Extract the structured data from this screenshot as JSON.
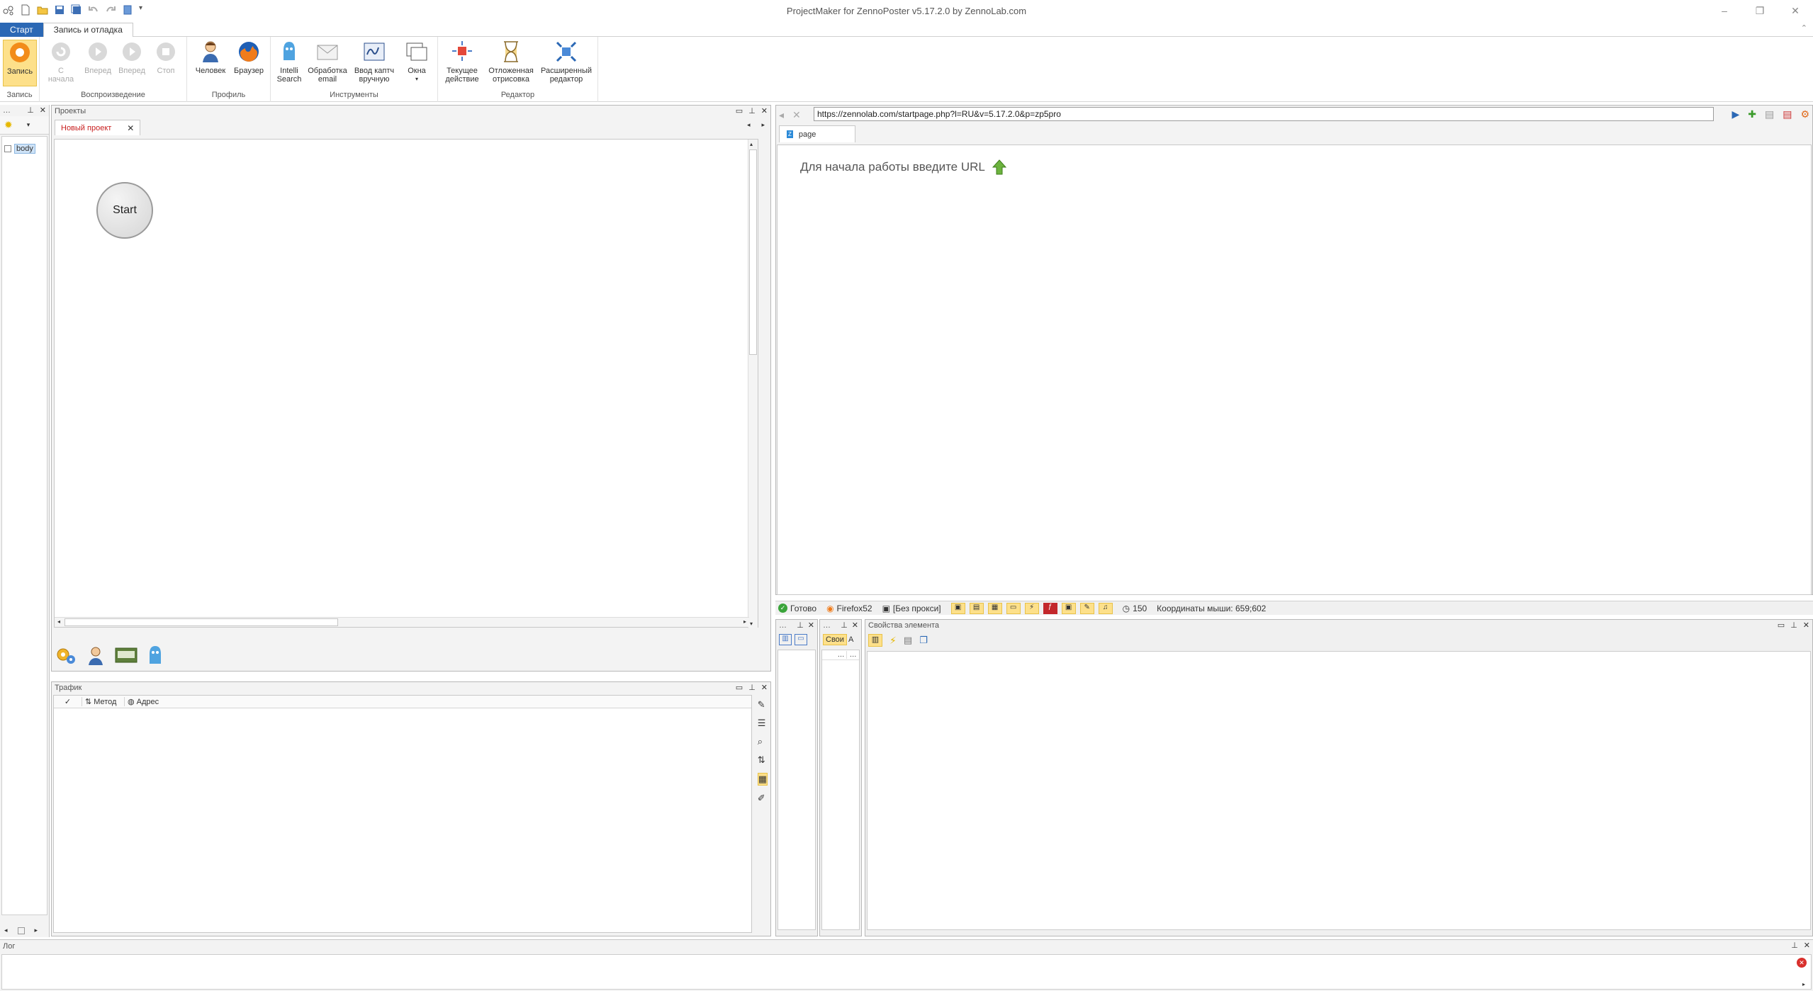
{
  "window": {
    "title": "ProjectMaker for ZennoPoster v5.17.2.0 by ZennoLab.com"
  },
  "ribbon_tabs": {
    "start": "Старт",
    "record_debug": "Запись и отладка"
  },
  "ribbon": {
    "record": {
      "label": "Запись",
      "group": "Запись"
    },
    "playback": {
      "from_start": "С начала",
      "forward1": "Вперед",
      "forward2": "Вперед",
      "stop": "Стоп",
      "group": "Воспроизведение"
    },
    "profile": {
      "human": "Человек",
      "browser": "Браузер",
      "group": "Профиль"
    },
    "tools": {
      "intelli1": "Intelli",
      "intelli2": "Search",
      "email1": "Обработка",
      "email2": "email",
      "captcha1": "Ввод каптч",
      "captcha2": "вручную",
      "windows": "Окна",
      "group": "Инструменты"
    },
    "editor": {
      "current1": "Текущее",
      "current2": "действие",
      "deferred1": "Отложенная",
      "deferred2": "отрисовка",
      "advanced1": "Расширенный",
      "advanced2": "редактор",
      "group": "Редактор"
    }
  },
  "left_panel": {
    "tree_item": "body"
  },
  "projects": {
    "title": "Проекты",
    "tab": "Новый проект",
    "start_node": "Start"
  },
  "traffic": {
    "title": "Трафик",
    "col_method": "Метод",
    "col_address": "Адрес"
  },
  "browser": {
    "url": "https://zennolab.com/startpage.php?l=RU&v=5.17.2.0&p=zp5pro",
    "tab": "page",
    "hint": "Для начала работы введите URL"
  },
  "status": {
    "ready": "Готово",
    "engine": "Firefox52",
    "proxy": "[Без прокси]",
    "count": "150",
    "mouse": "Координаты мыши: 659;602"
  },
  "element_props": {
    "title": "Свойства элемента",
    "tab_own": "Свои",
    "tab_a": "А"
  },
  "log": {
    "title": "Лог"
  },
  "colors": {
    "accent": "#2b68b5",
    "record": "#f28c1a",
    "highlight": "#fde08a"
  }
}
